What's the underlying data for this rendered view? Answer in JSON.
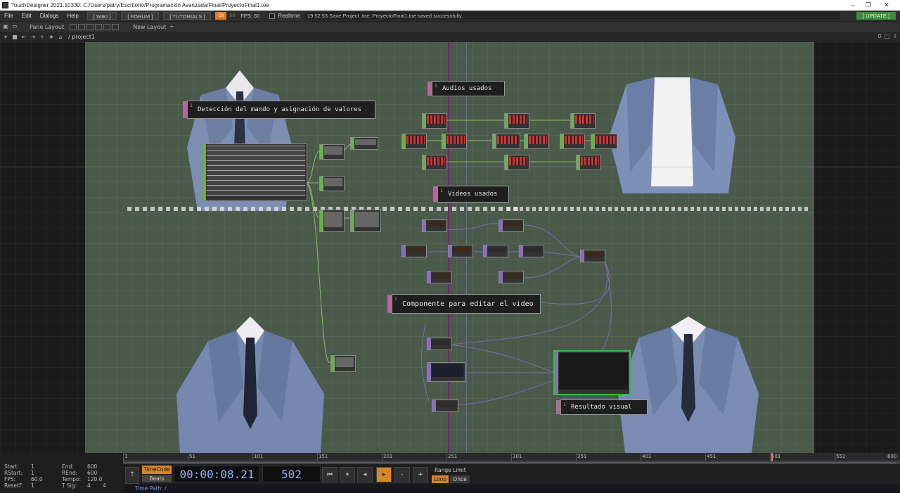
{
  "window": {
    "title": "TouchDesigner 2021.10330: C:/Users/patry/Escritorio/Programación Avanzada/Final/ProyectoFinal1.toe"
  },
  "menu": {
    "items": [
      "File",
      "Edit",
      "Dialogs",
      "Help"
    ],
    "wiki": "[ WIKI ]",
    "forum": "[ FORUM ]",
    "tutorials": "[ TUTORIALS ]",
    "oi": "OI",
    "fps_cap": "60",
    "fps": "FPS:  60",
    "realtime": "Realtime",
    "message": "19:52:53 Save Project .toe: ProyectoFinal1.toe saved successfully.",
    "update": "[ UPDATE ]"
  },
  "panebar": {
    "pane_layout": "Pane Layout",
    "new_layout": "New Layout",
    "plus": "+"
  },
  "pathbar": {
    "path": "/ project1",
    "zero": "0"
  },
  "comments": {
    "audios": "Audios usados",
    "deteccion": "Detección del mando y asignación de valores",
    "videos": "Videos usados",
    "componente": "Componente para editar el video",
    "resultado": "Resultado visual",
    "num": "1"
  },
  "timeline": {
    "start_l": "Start:",
    "start_v": "1",
    "end_l": "End:",
    "end_v": "600",
    "rstart_l": "RStart:",
    "rstart_v": "1",
    "rend_l": "REnd:",
    "rend_v": "600",
    "fps_l": "FPS:",
    "fps_v": "60.0",
    "tempo_l": "Tempo:",
    "tempo_v": "120.0",
    "resetf_l": "ResetF:",
    "resetf_v": "1",
    "tsig_l": "T Sig:",
    "tsig_v1": "4",
    "tsig_v2": "4",
    "ruler": [
      "1",
      "51",
      "101",
      "151",
      "201",
      "251",
      "301",
      "351",
      "401",
      "451",
      "501",
      "551",
      "600"
    ],
    "timecode_btn": "TimeCode",
    "beats_btn": "Beats",
    "timecode": "00:00:08.21",
    "frame": "502",
    "range_limit": "Range Limit",
    "loop": "Loop",
    "once": "Once",
    "time_path": "Time Path: /",
    "controls": {
      "start": "⏮",
      "pause": "⏸",
      "back": "◂",
      "play": "▸",
      "minus": "-",
      "plus": "+"
    }
  },
  "colors": {
    "accent": "#d8862a",
    "update": "#3a8c3a",
    "chop": "#6ab04c",
    "top": "#8a6cc0",
    "comp": "#c060a0"
  }
}
